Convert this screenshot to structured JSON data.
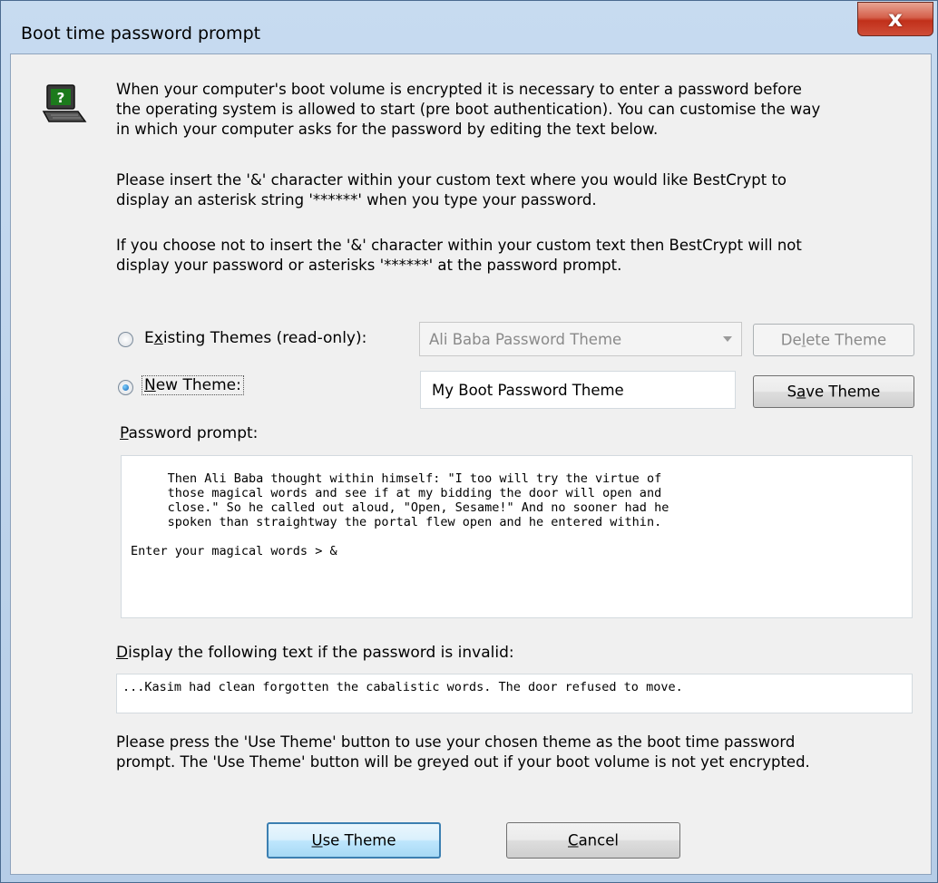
{
  "window": {
    "title": "Boot time password prompt",
    "close_glyph": "x"
  },
  "icons": {
    "computer": "computer-question-icon"
  },
  "intro": {
    "p1": "When your computer's boot volume is encrypted it is necessary to enter a password before\nthe operating system is allowed to start (pre boot authentication). You can customise the way\nin which your computer asks for the password by editing the text below.",
    "p2": "Please insert the '&' character within your custom text where you would like BestCrypt to\ndisplay an asterisk string '******' when you type your password.",
    "p3": "If you choose not to insert the '&' character within your custom text then BestCrypt will not\ndisplay your password or asterisks '******' at the password prompt."
  },
  "themes": {
    "existing_label": "Existing Themes (read-only):",
    "existing_selected": "Ali Baba Password Theme",
    "existing_checked": false,
    "delete_button": "Delete Theme",
    "new_label": "New Theme:",
    "new_checked": true,
    "new_value": "My Boot Password Theme",
    "save_button": "Save Theme"
  },
  "password_prompt": {
    "label": "Password prompt:",
    "text": "     Then Ali Baba thought within himself: \"I too will try the virtue of\n     those magical words and see if at my bidding the door will open and\n     close.\" So he called out aloud, \"Open, Sesame!\" And no sooner had he\n     spoken than straightway the portal flew open and he entered within.\n\nEnter your magical words > &"
  },
  "invalid_text": {
    "label": "Display the following text if the password is invalid:",
    "value": "...Kasim had clean forgotten the cabalistic words. The door refused to move."
  },
  "footer": {
    "note": "Please press the 'Use Theme' button to use your chosen theme as the boot time password\nprompt. The 'Use Theme' button will be greyed out if your boot volume is not yet encrypted.",
    "use_button": "Use Theme",
    "cancel_button": "Cancel"
  }
}
